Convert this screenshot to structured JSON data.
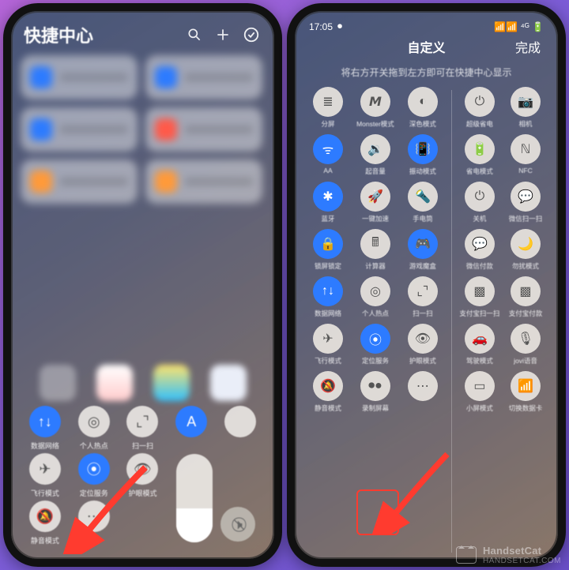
{
  "watermark": {
    "name": "HandsetCat",
    "url": "HANDSETCAT.COM"
  },
  "left_phone": {
    "title": "快捷中心",
    "header_icons": [
      "search-icon",
      "plus-icon",
      "check-circle-icon"
    ],
    "tiles": [
      {
        "color": "blue"
      },
      {
        "color": "blue"
      },
      {
        "color": "blue"
      },
      {
        "color": "red"
      },
      {
        "color": "orange"
      },
      {
        "color": "orange"
      }
    ],
    "dock_apps": [
      "g",
      "r",
      "y",
      "w"
    ],
    "row1": [
      {
        "icon": "↑↓",
        "label": "数据网络",
        "state": "on"
      },
      {
        "icon": "◎",
        "label": "个人热点",
        "state": "off"
      },
      {
        "icon": "⌞⌝",
        "label": "扫一扫",
        "state": "off"
      },
      {
        "icon": "A",
        "label": "",
        "state": "on"
      },
      {
        "icon": "",
        "label": "",
        "state": "off"
      }
    ],
    "row2": [
      {
        "icon": "✈",
        "label": "飞行模式",
        "state": "off"
      },
      {
        "icon": "⦿",
        "label": "定位服务",
        "state": "on"
      },
      {
        "icon": "👁",
        "label": "护眼模式",
        "state": "off"
      }
    ],
    "row3": [
      {
        "icon": "🔕",
        "label": "静音模式",
        "state": "off"
      },
      {
        "icon": "⋯",
        "label": "",
        "state": "off"
      }
    ],
    "brightness": {
      "sun": "☀",
      "mute": "🕨⃠"
    }
  },
  "right_phone": {
    "status_time": "17:05",
    "title": "自定义",
    "done": "完成",
    "hint": "将右方开关拖到左方即可在快捷中心显示",
    "left_col": [
      {
        "icon": "≣",
        "label": "分屏",
        "state": "off"
      },
      {
        "icon": "𝙈",
        "label": "Monster模式",
        "state": "off"
      },
      {
        "icon": "◐",
        "label": "深色模式",
        "state": "off"
      },
      {
        "icon": "ᯤ",
        "label": "AA",
        "state": "on"
      },
      {
        "icon": "🔉",
        "label": "起音量",
        "state": "off"
      },
      {
        "icon": "📳",
        "label": "振动模式",
        "state": "on"
      },
      {
        "icon": "✱",
        "label": "蓝牙",
        "state": "on"
      },
      {
        "icon": "🚀",
        "label": "一键加速",
        "state": "off"
      },
      {
        "icon": "🔦",
        "label": "手电筒",
        "state": "off"
      },
      {
        "icon": "🔒",
        "label": "锁屏锁定",
        "state": "on"
      },
      {
        "icon": "🖩",
        "label": "计算器",
        "state": "off"
      },
      {
        "icon": "🎮",
        "label": "游戏魔盒",
        "state": "on"
      },
      {
        "icon": "↑↓",
        "label": "数据网络",
        "state": "on"
      },
      {
        "icon": "◎",
        "label": "个人热点",
        "state": "off"
      },
      {
        "icon": "⌞⌝",
        "label": "扫一扫",
        "state": "off"
      },
      {
        "icon": "✈",
        "label": "飞行模式",
        "state": "off"
      },
      {
        "icon": "⦿",
        "label": "定位服务",
        "state": "on"
      },
      {
        "icon": "👁",
        "label": "护眼模式",
        "state": "off"
      },
      {
        "icon": "🔕",
        "label": "静音模式",
        "state": "off"
      },
      {
        "icon": "⏺●",
        "label": "录制屏幕",
        "state": "off"
      },
      {
        "icon": "⋯",
        "label": "",
        "state": "off"
      }
    ],
    "right_col": [
      {
        "icon": "⏻",
        "label": "超级省电",
        "state": "off"
      },
      {
        "icon": "📷",
        "label": "相机",
        "state": "off"
      },
      {
        "icon": "🔋",
        "label": "省电模式",
        "state": "off"
      },
      {
        "icon": "ℕ",
        "label": "NFC",
        "state": "off"
      },
      {
        "icon": "⏻",
        "label": "关机",
        "state": "off"
      },
      {
        "icon": "💬",
        "label": "微信扫一扫",
        "state": "off"
      },
      {
        "icon": "💬",
        "label": "微信付款",
        "state": "off"
      },
      {
        "icon": "🌙",
        "label": "勿扰模式",
        "state": "off"
      },
      {
        "icon": "▩",
        "label": "支付宝扫一扫",
        "state": "off"
      },
      {
        "icon": "▩",
        "label": "支付宝付款",
        "state": "off"
      },
      {
        "icon": "🚗",
        "label": "驾驶模式",
        "state": "off"
      },
      {
        "icon": "🎙",
        "label": "jovi语音",
        "state": "off"
      },
      {
        "icon": "▭",
        "label": "小屏模式",
        "state": "off"
      },
      {
        "icon": "📶",
        "label": "切换数据卡",
        "state": "off"
      }
    ]
  }
}
